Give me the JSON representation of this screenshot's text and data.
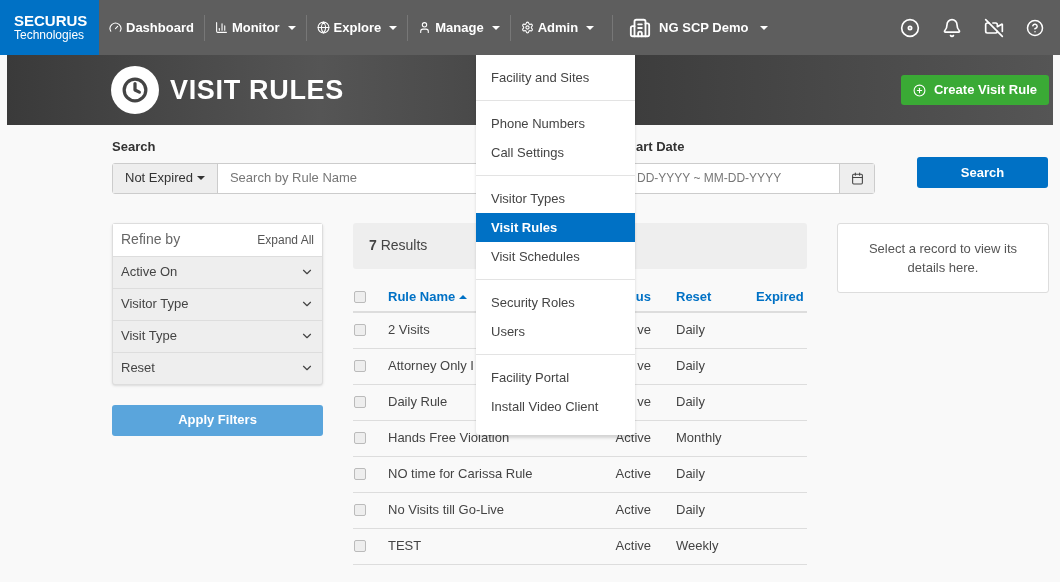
{
  "logo": {
    "line1": "SECURUS",
    "line2": "Technologies"
  },
  "nav": [
    {
      "label": "Dashboard",
      "caret": false
    },
    {
      "label": "Monitor",
      "caret": true
    },
    {
      "label": "Explore",
      "caret": true
    },
    {
      "label": "Manage",
      "caret": true
    },
    {
      "label": "Admin",
      "caret": true
    }
  ],
  "facility": {
    "label": "NG SCP Demo"
  },
  "page_title": "VISIT RULES",
  "create_button": "Create Visit Rule",
  "search": {
    "label": "Search",
    "filter": "Not Expired",
    "placeholder": "Search by Rule Name"
  },
  "date": {
    "label": "art Date",
    "placeholder": "DD-YYYY ~ MM-DD-YYYY"
  },
  "search_button": "Search",
  "refine": {
    "title": "Refine by",
    "expand_all": "Expand All",
    "groups": [
      "Active On",
      "Visitor Type",
      "Visit Type",
      "Reset"
    ]
  },
  "apply_button": "Apply Filters",
  "results": {
    "count": "7",
    "label": "Results"
  },
  "table": {
    "select_all": {
      "checked": false
    },
    "columns": [
      "Rule Name",
      "us",
      "Reset",
      "Expired"
    ],
    "rows": [
      {
        "name": "2 Visits",
        "status": "ve",
        "reset": "Daily",
        "checked": false
      },
      {
        "name": "Attorney Only I",
        "status": "ve",
        "reset": "Daily",
        "checked": false
      },
      {
        "name": "Daily Rule",
        "status": "ve",
        "reset": "Daily",
        "checked": false
      },
      {
        "name": "Hands Free Violation",
        "status": "Active",
        "reset": "Monthly",
        "checked": false
      },
      {
        "name": "NO time for Carissa Rule",
        "status": "Active",
        "reset": "Daily",
        "checked": false
      },
      {
        "name": "No Visits till Go-Live",
        "status": "Active",
        "reset": "Daily",
        "checked": false
      },
      {
        "name": "TEST",
        "status": "Active",
        "reset": "Weekly",
        "checked": false
      }
    ]
  },
  "details_hint": "Select a record to view its details here.",
  "admin_menu": [
    [
      {
        "label": "Facility and Sites",
        "selected": false
      }
    ],
    [
      {
        "label": "Phone Numbers",
        "selected": false
      },
      {
        "label": "Call Settings",
        "selected": false
      }
    ],
    [
      {
        "label": "Visitor Types",
        "selected": false
      },
      {
        "label": "Visit Rules",
        "selected": true
      },
      {
        "label": "Visit Schedules",
        "selected": false
      }
    ],
    [
      {
        "label": "Security Roles",
        "selected": false
      },
      {
        "label": "Users",
        "selected": false
      }
    ],
    [
      {
        "label": "Facility Portal",
        "selected": false
      },
      {
        "label": "Install Video Client",
        "selected": false
      }
    ]
  ]
}
